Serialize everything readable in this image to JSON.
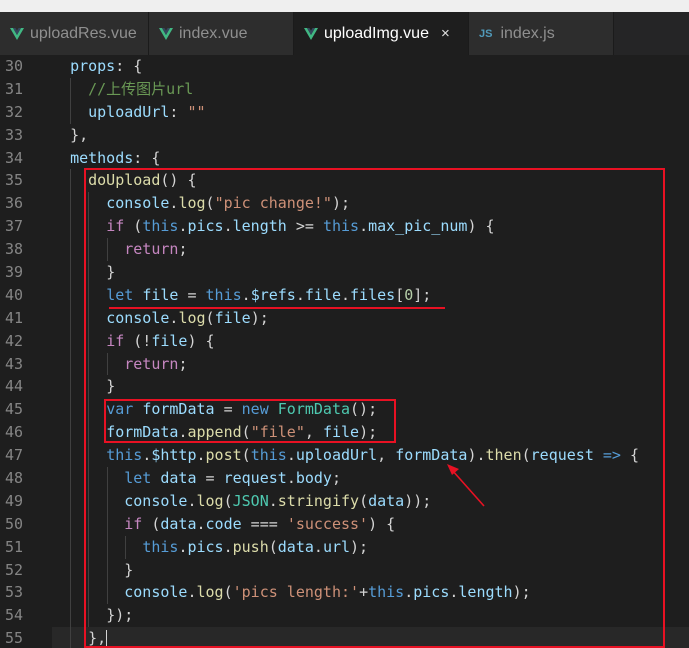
{
  "tabs": [
    {
      "label": "uploadRes.vue",
      "icon": "vue-icon",
      "active": false
    },
    {
      "label": "index.vue",
      "icon": "vue-icon",
      "active": false
    },
    {
      "label": "uploadImg.vue",
      "icon": "vue-icon",
      "active": true,
      "close_symbol": "×"
    },
    {
      "label": "index.js",
      "icon": "js-icon",
      "icon_text": "JS",
      "active": false
    }
  ],
  "colors": {
    "editor_bg": "#1e1e1e",
    "tab_bg": "#2d2d2d",
    "active_tab_bg": "#1e1e1e",
    "annotation": "#e81123",
    "vue_green": "#41b883"
  },
  "editor": {
    "lines": [
      {
        "n": "30",
        "indent": 2,
        "tokens": [
          [
            "prop",
            "props"
          ],
          [
            "plain",
            ": {"
          ]
        ]
      },
      {
        "n": "31",
        "indent": 4,
        "tokens": [
          [
            "cmt",
            "//上传图片url"
          ]
        ]
      },
      {
        "n": "32",
        "indent": 4,
        "tokens": [
          [
            "prop",
            "uploadUrl"
          ],
          [
            "plain",
            ": "
          ],
          [
            "str",
            "\"\""
          ]
        ]
      },
      {
        "n": "33",
        "indent": 2,
        "tokens": [
          [
            "plain",
            "},"
          ]
        ]
      },
      {
        "n": "34",
        "indent": 2,
        "tokens": [
          [
            "prop",
            "methods"
          ],
          [
            "plain",
            ": {"
          ]
        ]
      },
      {
        "n": "35",
        "indent": 4,
        "tokens": [
          [
            "fn",
            "doUpload"
          ],
          [
            "plain",
            "() {"
          ]
        ]
      },
      {
        "n": "36",
        "indent": 6,
        "tokens": [
          [
            "prop",
            "console"
          ],
          [
            "plain",
            "."
          ],
          [
            "fn",
            "log"
          ],
          [
            "plain",
            "("
          ],
          [
            "str",
            "\"pic change!\""
          ],
          [
            "plain",
            ");"
          ]
        ]
      },
      {
        "n": "37",
        "indent": 6,
        "tokens": [
          [
            "ctrl",
            "if"
          ],
          [
            "plain",
            " ("
          ],
          [
            "kw",
            "this"
          ],
          [
            "plain",
            "."
          ],
          [
            "prop",
            "pics"
          ],
          [
            "plain",
            "."
          ],
          [
            "prop",
            "length"
          ],
          [
            "plain",
            " >= "
          ],
          [
            "kw",
            "this"
          ],
          [
            "plain",
            "."
          ],
          [
            "prop",
            "max_pic_num"
          ],
          [
            "plain",
            ") {"
          ]
        ]
      },
      {
        "n": "38",
        "indent": 8,
        "tokens": [
          [
            "ctrl",
            "return"
          ],
          [
            "plain",
            ";"
          ]
        ]
      },
      {
        "n": "39",
        "indent": 6,
        "tokens": [
          [
            "plain",
            "}"
          ]
        ]
      },
      {
        "n": "40",
        "indent": 6,
        "tokens": [
          [
            "kw",
            "let"
          ],
          [
            "plain",
            " "
          ],
          [
            "prop",
            "file"
          ],
          [
            "plain",
            " = "
          ],
          [
            "kw",
            "this"
          ],
          [
            "plain",
            "."
          ],
          [
            "prop",
            "$refs"
          ],
          [
            "plain",
            "."
          ],
          [
            "prop",
            "file"
          ],
          [
            "plain",
            "."
          ],
          [
            "prop",
            "files"
          ],
          [
            "plain",
            "["
          ],
          [
            "num",
            "0"
          ],
          [
            "plain",
            "];"
          ]
        ]
      },
      {
        "n": "41",
        "indent": 6,
        "tokens": [
          [
            "prop",
            "console"
          ],
          [
            "plain",
            "."
          ],
          [
            "fn",
            "log"
          ],
          [
            "plain",
            "("
          ],
          [
            "prop",
            "file"
          ],
          [
            "plain",
            ");"
          ]
        ]
      },
      {
        "n": "42",
        "indent": 6,
        "tokens": [
          [
            "ctrl",
            "if"
          ],
          [
            "plain",
            " (!"
          ],
          [
            "prop",
            "file"
          ],
          [
            "plain",
            ") {"
          ]
        ]
      },
      {
        "n": "43",
        "indent": 8,
        "tokens": [
          [
            "ctrl",
            "return"
          ],
          [
            "plain",
            ";"
          ]
        ]
      },
      {
        "n": "44",
        "indent": 6,
        "tokens": [
          [
            "plain",
            "}"
          ]
        ]
      },
      {
        "n": "45",
        "indent": 6,
        "tokens": [
          [
            "kw",
            "var"
          ],
          [
            "plain",
            " "
          ],
          [
            "prop",
            "formData"
          ],
          [
            "plain",
            " = "
          ],
          [
            "kw",
            "new"
          ],
          [
            "plain",
            " "
          ],
          [
            "cls",
            "FormData"
          ],
          [
            "plain",
            "();"
          ]
        ]
      },
      {
        "n": "46",
        "indent": 6,
        "tokens": [
          [
            "prop",
            "formData"
          ],
          [
            "plain",
            "."
          ],
          [
            "fn",
            "append"
          ],
          [
            "plain",
            "("
          ],
          [
            "str",
            "\"file\""
          ],
          [
            "plain",
            ", "
          ],
          [
            "prop",
            "file"
          ],
          [
            "plain",
            ");"
          ]
        ]
      },
      {
        "n": "47",
        "indent": 6,
        "tokens": [
          [
            "kw",
            "this"
          ],
          [
            "plain",
            "."
          ],
          [
            "prop",
            "$http"
          ],
          [
            "plain",
            "."
          ],
          [
            "fn",
            "post"
          ],
          [
            "plain",
            "("
          ],
          [
            "kw",
            "this"
          ],
          [
            "plain",
            "."
          ],
          [
            "prop",
            "uploadUrl"
          ],
          [
            "plain",
            ", "
          ],
          [
            "prop",
            "formData"
          ],
          [
            "plain",
            ")."
          ],
          [
            "fn",
            "then"
          ],
          [
            "plain",
            "("
          ],
          [
            "prop",
            "request"
          ],
          [
            "plain",
            " "
          ],
          [
            "kw",
            "=>"
          ],
          [
            "plain",
            " {"
          ]
        ]
      },
      {
        "n": "48",
        "indent": 8,
        "tokens": [
          [
            "kw",
            "let"
          ],
          [
            "plain",
            " "
          ],
          [
            "prop",
            "data"
          ],
          [
            "plain",
            " = "
          ],
          [
            "prop",
            "request"
          ],
          [
            "plain",
            "."
          ],
          [
            "prop",
            "body"
          ],
          [
            "plain",
            ";"
          ]
        ]
      },
      {
        "n": "49",
        "indent": 8,
        "tokens": [
          [
            "prop",
            "console"
          ],
          [
            "plain",
            "."
          ],
          [
            "fn",
            "log"
          ],
          [
            "plain",
            "("
          ],
          [
            "cls",
            "JSON"
          ],
          [
            "plain",
            "."
          ],
          [
            "fn",
            "stringify"
          ],
          [
            "plain",
            "("
          ],
          [
            "prop",
            "data"
          ],
          [
            "plain",
            "));"
          ]
        ]
      },
      {
        "n": "50",
        "indent": 8,
        "tokens": [
          [
            "ctrl",
            "if"
          ],
          [
            "plain",
            " ("
          ],
          [
            "prop",
            "data"
          ],
          [
            "plain",
            "."
          ],
          [
            "prop",
            "code"
          ],
          [
            "plain",
            " === "
          ],
          [
            "str",
            "'success'"
          ],
          [
            "plain",
            ") {"
          ]
        ]
      },
      {
        "n": "51",
        "indent": 10,
        "tokens": [
          [
            "kw",
            "this"
          ],
          [
            "plain",
            "."
          ],
          [
            "prop",
            "pics"
          ],
          [
            "plain",
            "."
          ],
          [
            "fn",
            "push"
          ],
          [
            "plain",
            "("
          ],
          [
            "prop",
            "data"
          ],
          [
            "plain",
            "."
          ],
          [
            "prop",
            "url"
          ],
          [
            "plain",
            ");"
          ]
        ]
      },
      {
        "n": "52",
        "indent": 8,
        "tokens": [
          [
            "plain",
            "}"
          ]
        ]
      },
      {
        "n": "53",
        "indent": 8,
        "tokens": [
          [
            "prop",
            "console"
          ],
          [
            "plain",
            "."
          ],
          [
            "fn",
            "log"
          ],
          [
            "plain",
            "("
          ],
          [
            "str",
            "'pics length:'"
          ],
          [
            "plain",
            "+"
          ],
          [
            "kw",
            "this"
          ],
          [
            "plain",
            "."
          ],
          [
            "prop",
            "pics"
          ],
          [
            "plain",
            "."
          ],
          [
            "prop",
            "length"
          ],
          [
            "plain",
            ");"
          ]
        ]
      },
      {
        "n": "54",
        "indent": 6,
        "tokens": [
          [
            "plain",
            "});"
          ]
        ]
      },
      {
        "n": "55",
        "indent": 4,
        "tokens": [
          [
            "plain",
            "},"
          ]
        ],
        "cursor": true
      }
    ]
  }
}
